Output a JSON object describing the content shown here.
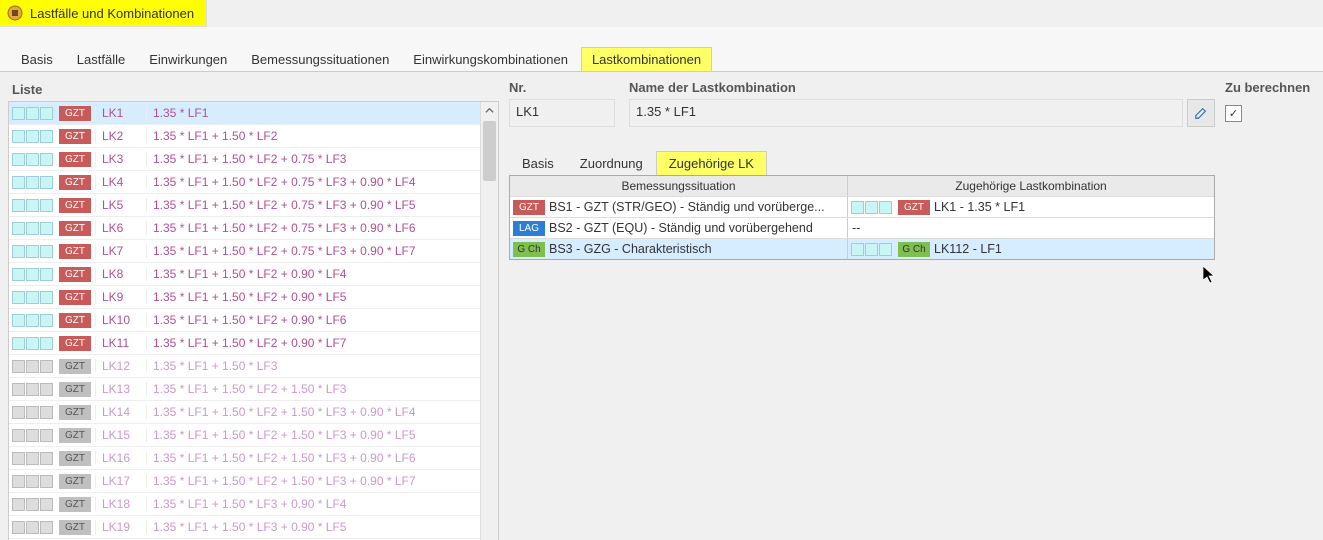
{
  "window": {
    "title": "Lastfälle und Kombinationen"
  },
  "mainTabs": [
    "Basis",
    "Lastfälle",
    "Einwirkungen",
    "Bemessungssituationen",
    "Einwirkungskombinationen",
    "Lastkombinationen"
  ],
  "mainTabActive": 5,
  "listHeader": "Liste",
  "list": [
    {
      "badge": "GZT",
      "style": "gzt-red",
      "lk": "LK1",
      "f": "1.35 * LF1",
      "sel": true,
      "grey": false
    },
    {
      "badge": "GZT",
      "style": "gzt-red",
      "lk": "LK2",
      "f": "1.35 * LF1 + 1.50 * LF2",
      "grey": false
    },
    {
      "badge": "GZT",
      "style": "gzt-red",
      "lk": "LK3",
      "f": "1.35 * LF1 + 1.50 * LF2 + 0.75 * LF3",
      "grey": false
    },
    {
      "badge": "GZT",
      "style": "gzt-red",
      "lk": "LK4",
      "f": "1.35 * LF1 + 1.50 * LF2 + 0.75 * LF3 + 0.90 * LF4",
      "grey": false
    },
    {
      "badge": "GZT",
      "style": "gzt-red",
      "lk": "LK5",
      "f": "1.35 * LF1 + 1.50 * LF2 + 0.75 * LF3 + 0.90 * LF5",
      "grey": false
    },
    {
      "badge": "GZT",
      "style": "gzt-red",
      "lk": "LK6",
      "f": "1.35 * LF1 + 1.50 * LF2 + 0.75 * LF3 + 0.90 * LF6",
      "grey": false
    },
    {
      "badge": "GZT",
      "style": "gzt-red",
      "lk": "LK7",
      "f": "1.35 * LF1 + 1.50 * LF2 + 0.75 * LF3 + 0.90 * LF7",
      "grey": false
    },
    {
      "badge": "GZT",
      "style": "gzt-red",
      "lk": "LK8",
      "f": "1.35 * LF1 + 1.50 * LF2 + 0.90 * LF4",
      "grey": false
    },
    {
      "badge": "GZT",
      "style": "gzt-red",
      "lk": "LK9",
      "f": "1.35 * LF1 + 1.50 * LF2 + 0.90 * LF5",
      "grey": false
    },
    {
      "badge": "GZT",
      "style": "gzt-red",
      "lk": "LK10",
      "f": "1.35 * LF1 + 1.50 * LF2 + 0.90 * LF6",
      "grey": false
    },
    {
      "badge": "GZT",
      "style": "gzt-red",
      "lk": "LK11",
      "f": "1.35 * LF1 + 1.50 * LF2 + 0.90 * LF7",
      "grey": false
    },
    {
      "badge": "GZT",
      "style": "gzt-grey",
      "lk": "LK12",
      "f": "1.35 * LF1 + 1.50 * LF3",
      "grey": true
    },
    {
      "badge": "GZT",
      "style": "gzt-grey",
      "lk": "LK13",
      "f": "1.35 * LF1 + 1.50 * LF2 + 1.50 * LF3",
      "grey": true
    },
    {
      "badge": "GZT",
      "style": "gzt-grey",
      "lk": "LK14",
      "f": "1.35 * LF1 + 1.50 * LF2 + 1.50 * LF3 + 0.90 * LF4",
      "grey": true
    },
    {
      "badge": "GZT",
      "style": "gzt-grey",
      "lk": "LK15",
      "f": "1.35 * LF1 + 1.50 * LF2 + 1.50 * LF3 + 0.90 * LF5",
      "grey": true
    },
    {
      "badge": "GZT",
      "style": "gzt-grey",
      "lk": "LK16",
      "f": "1.35 * LF1 + 1.50 * LF2 + 1.50 * LF3 + 0.90 * LF6",
      "grey": true
    },
    {
      "badge": "GZT",
      "style": "gzt-grey",
      "lk": "LK17",
      "f": "1.35 * LF1 + 1.50 * LF2 + 1.50 * LF3 + 0.90 * LF7",
      "grey": true
    },
    {
      "badge": "GZT",
      "style": "gzt-grey",
      "lk": "LK18",
      "f": "1.35 * LF1 + 1.50 * LF3 + 0.90 * LF4",
      "grey": true
    },
    {
      "badge": "GZT",
      "style": "gzt-grey",
      "lk": "LK19",
      "f": "1.35 * LF1 + 1.50 * LF3 + 0.90 * LF5",
      "grey": true
    }
  ],
  "nrLabel": "Nr.",
  "nrValue": "LK1",
  "nameLabel": "Name der Lastkombination",
  "nameValue": "1.35 * LF1",
  "calcLabel": "Zu berechnen",
  "calcChecked": "✓",
  "subTabs": [
    "Basis",
    "Zuordnung",
    "Zugehörige LK"
  ],
  "subTabActive": 2,
  "gridHeaders": [
    "Bemessungssituation",
    "Zugehörige Lastkombination"
  ],
  "gridRows": [
    {
      "b": "GZT",
      "bs": "gzt-red",
      "t1": "BS1 - GZT (STR/GEO) - Ständig und vorüberge...",
      "rb": "GZT",
      "rbs": "gzt-red",
      "t2": "LK1 - 1.35 * LF1",
      "ind": true
    },
    {
      "b": "LAG",
      "bs": "lag",
      "t1": "BS2 - GZT (EQU) - Ständig und vorübergehend",
      "t2": "--"
    },
    {
      "b": "G Ch",
      "bs": "gch",
      "t1": "BS3 - GZG - Charakteristisch",
      "rb": "G Ch",
      "rbs": "gch",
      "t2": "LK112 - LF1",
      "sel": true,
      "ind": true
    }
  ]
}
